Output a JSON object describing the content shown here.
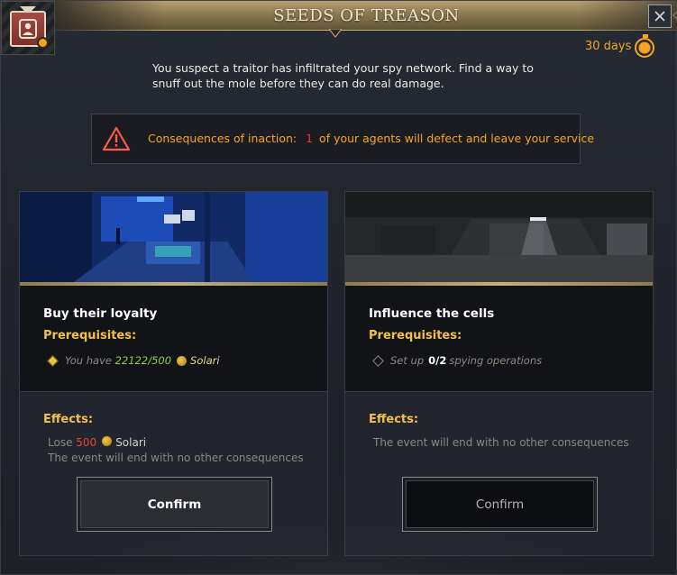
{
  "window": {
    "title": "SEEDS OF TREASON",
    "close_icon": "close-icon",
    "badge_icon": "agent-portrait-icon"
  },
  "timer": {
    "label": "30 days",
    "icon": "timer-icon",
    "color": "#f5a524"
  },
  "description": "You suspect a traitor has infiltrated your spy network. Find a way to snuff out the mole before they can do real damage.",
  "consequence": {
    "icon": "warning-icon",
    "label": "Consequences of inaction:",
    "number": "1",
    "text": "of your agents will defect and leave your service"
  },
  "options": [
    {
      "title": "Buy their loyalty",
      "prereq_heading": "Prerequisites:",
      "prereq": {
        "prefix": "You have",
        "value": "22122/500",
        "currency": "Solari",
        "met": true
      },
      "effects_heading": "Effects:",
      "effects": {
        "cost_prefix": "Lose",
        "cost_value": "500",
        "cost_currency": "Solari",
        "note": "The event will end with no other consequences"
      },
      "confirm_label": "Confirm",
      "enabled": true
    },
    {
      "title": "Influence the cells",
      "prereq_heading": "Prerequisites:",
      "prereq": {
        "prefix": "Set up",
        "value": "0/2",
        "suffix": "spying operations",
        "met": false
      },
      "effects_heading": "Effects:",
      "effects": {
        "note": "The event will end with no other consequences"
      },
      "confirm_label": "Confirm",
      "enabled": false
    }
  ],
  "colors": {
    "accent_gold": "#f2c14b",
    "warning_orange": "#f5a524",
    "danger_red": "#e3423a",
    "positive_green": "#8fcf3f"
  }
}
